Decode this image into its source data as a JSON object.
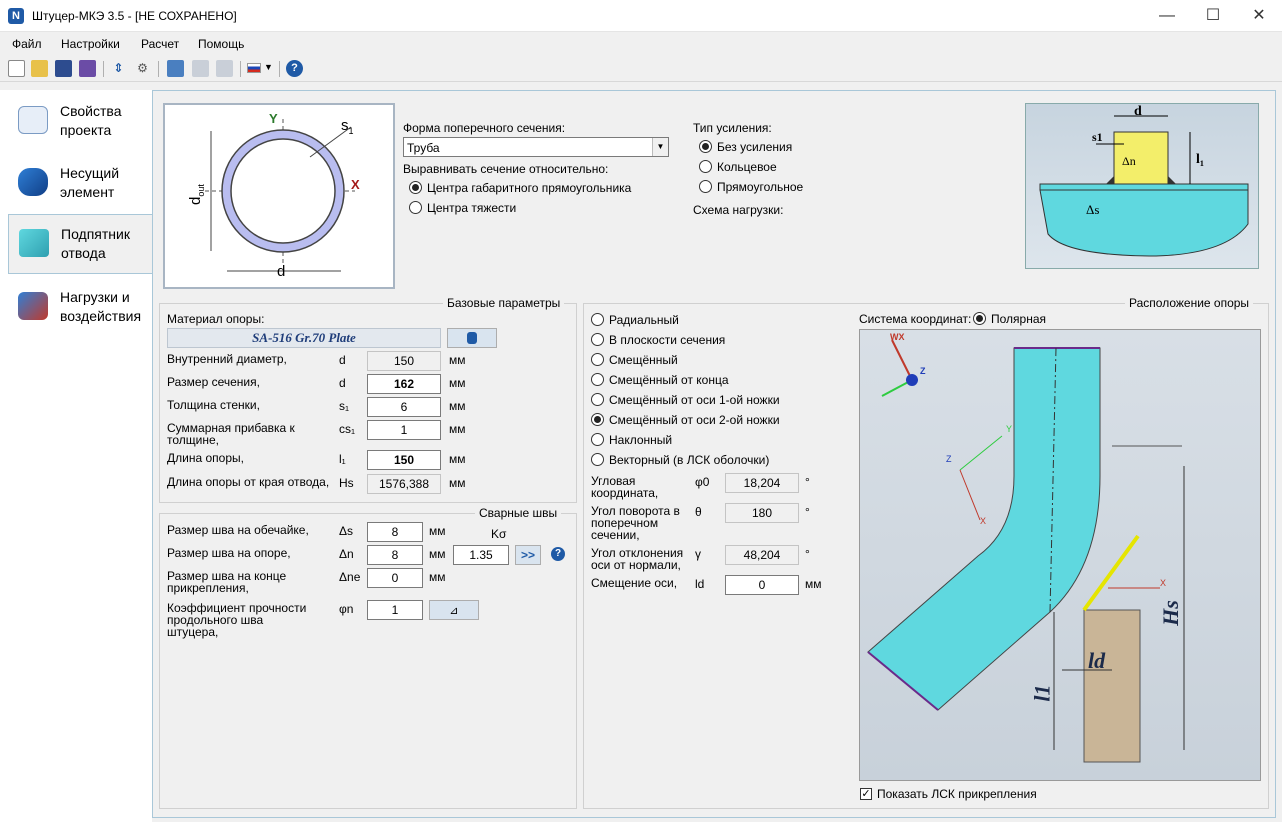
{
  "window": {
    "title": "Штуцер-МКЭ 3.5 - [НЕ СОХРАНЕНО]",
    "app_icon": "N"
  },
  "menu": [
    "Файл",
    "Настройки",
    "Расчет",
    "Помощь"
  ],
  "sidebar": {
    "items": [
      {
        "label1": "Свойства",
        "label2": "проекта",
        "icon": "document-icon",
        "active": false
      },
      {
        "label1": "Несущий",
        "label2": "элемент",
        "icon": "cylinder-icon",
        "active": false
      },
      {
        "label1": "Подпятник",
        "label2": "отвода",
        "icon": "elbow-icon",
        "active": true
      },
      {
        "label1": "Нагрузки и",
        "label2": "воздействия",
        "icon": "load-icon",
        "active": false
      }
    ]
  },
  "section": {
    "shape_label": "Форма поперечного сечения:",
    "shape_value": "Труба",
    "align_label": "Выравнивать сечение относительно:",
    "align_options": [
      "Центра габаритного прямоугольника",
      "Центра тяжести"
    ],
    "align_selected": 0,
    "diagram": {
      "y": "Y",
      "x": "X",
      "s1": "s",
      "s1_sub": "1",
      "dout": "d",
      "dout_sub": "out",
      "d": "d"
    }
  },
  "reinforcement": {
    "label": "Тип усиления:",
    "options": [
      "Без усиления",
      "Кольцевое",
      "Прямоугольное"
    ],
    "selected": 0,
    "scheme_label": "Схема нагрузки:",
    "diagram": {
      "d": "d",
      "s1": "s1",
      "l1": "l₁",
      "dn": "Δn",
      "ds": "Δs"
    }
  },
  "base_params": {
    "title": "Базовые параметры",
    "material_label": "Материал опоры:",
    "material_value": "SA-516 Gr.70 Plate",
    "rows": [
      {
        "label": "Внутренний диаметр,",
        "sym": "d",
        "value": "150",
        "unit": "мм",
        "style": "ro"
      },
      {
        "label": "Размер сечения,",
        "sym": "d",
        "value": "162",
        "unit": "мм",
        "style": "bold"
      },
      {
        "label": "Толщина стенки,",
        "sym": "s₁",
        "value": "6",
        "unit": "мм",
        "style": ""
      },
      {
        "label": "Суммарная прибавка к толщине,",
        "sym": "cs₁",
        "value": "1",
        "unit": "мм",
        "style": ""
      },
      {
        "label": "Длина опоры,",
        "sym": "l₁",
        "value": "150",
        "unit": "мм",
        "style": "bold"
      },
      {
        "label": "Длина опоры от края отвода,",
        "sym": "Hs",
        "value": "1576,388",
        "unit": "мм",
        "style": "ro"
      }
    ]
  },
  "welds": {
    "title": "Сварные швы",
    "k_label": "Kσ",
    "k_value": "1.35",
    "arrow_label": ">>",
    "rows": [
      {
        "label": "Размер шва на обечайке,",
        "sym": "Δs",
        "value": "8",
        "unit": "мм"
      },
      {
        "label": "Размер шва на опоре,",
        "sym": "Δn",
        "value": "8",
        "unit": "мм"
      },
      {
        "label": "Размер шва на конце прикрепления,",
        "sym": "Δne",
        "value": "0",
        "unit": "мм"
      },
      {
        "label": "Коэффициент прочности продольного шва штуцера,",
        "sym": "φn",
        "value": "1",
        "unit": ""
      }
    ]
  },
  "position": {
    "title": "Расположение опоры",
    "options": [
      "Радиальный",
      "В плоскости сечения",
      "Смещённый",
      "Смещённый от конца",
      "Смещённый от оси 1-ой ножки",
      "Смещённый от оси 2-ой ножки",
      "Наклонный",
      "Векторный (в ЛСК оболочки)"
    ],
    "selected": 5,
    "coord_label": "Система координат:",
    "coord_value": "Полярная",
    "params": [
      {
        "label": "Угловая координата,",
        "sym": "φ0",
        "value": "18,204",
        "unit": "°"
      },
      {
        "label": "Угол поворота в поперечном сечении,",
        "sym": "θ",
        "value": "180",
        "unit": "°"
      },
      {
        "label": "Угол отклонения оси от нормали,",
        "sym": "γ",
        "value": "48,204",
        "unit": "°"
      },
      {
        "label": "Смещение оси,",
        "sym": "ld",
        "value": "0",
        "unit": "мм"
      }
    ],
    "show_lcs_label": "Показать ЛСК прикрепления",
    "show_lcs": true,
    "view": {
      "wx": "WX",
      "z": "Z",
      "y": "Y",
      "x": "X",
      "hs": "Hs",
      "l1": "l1",
      "ld": "ld"
    }
  },
  "colors": {
    "accent": "#1f5aa6",
    "pipe": "#5fd8df",
    "support": "#c9b597",
    "weld": "#e5e500"
  }
}
